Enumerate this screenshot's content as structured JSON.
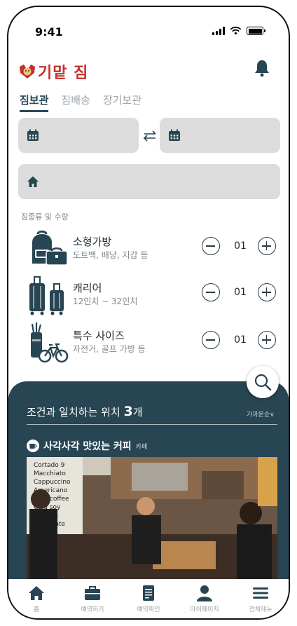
{
  "status_bar": {
    "time": "9:41"
  },
  "header": {
    "logo_text": "기맡 짐"
  },
  "tabs": [
    {
      "label": "짐보관",
      "active": true
    },
    {
      "label": "짐배송",
      "active": false
    },
    {
      "label": "장기보관",
      "active": false
    }
  ],
  "form": {
    "date_start_value": "",
    "date_end_value": "",
    "address_value": ""
  },
  "luggage": {
    "section_label": "짐종류 및 수량",
    "items": [
      {
        "name": "소형가방",
        "desc": "도트백, 배낭, 지갑 등",
        "qty": "01",
        "icon": "small-bag-icon"
      },
      {
        "name": "캐리어",
        "desc": "12인치 ~ 32인치",
        "qty": "01",
        "icon": "suitcase-icon"
      },
      {
        "name": "특수 사이즈",
        "desc": "자전거, 골프 가방 등",
        "qty": "01",
        "icon": "golf-bike-icon"
      }
    ]
  },
  "results": {
    "title_prefix": "조건과 일치하는 위치",
    "count": "3",
    "count_suffix": "개",
    "sort_label": "가까운순∨",
    "first": {
      "name": "사각사각 맛있는 커피",
      "category": "카페"
    }
  },
  "nav": [
    {
      "label": "홈",
      "icon": "home-icon"
    },
    {
      "label": "예약하기",
      "icon": "briefcase-icon"
    },
    {
      "label": "예약확인",
      "icon": "document-icon"
    },
    {
      "label": "마이페이지",
      "icon": "person-icon"
    },
    {
      "label": "전체메뉴",
      "icon": "menu-icon"
    }
  ],
  "colors": {
    "primary": "#274553",
    "logo_red": "#c5302a",
    "input_bg": "#dcdcdc"
  }
}
